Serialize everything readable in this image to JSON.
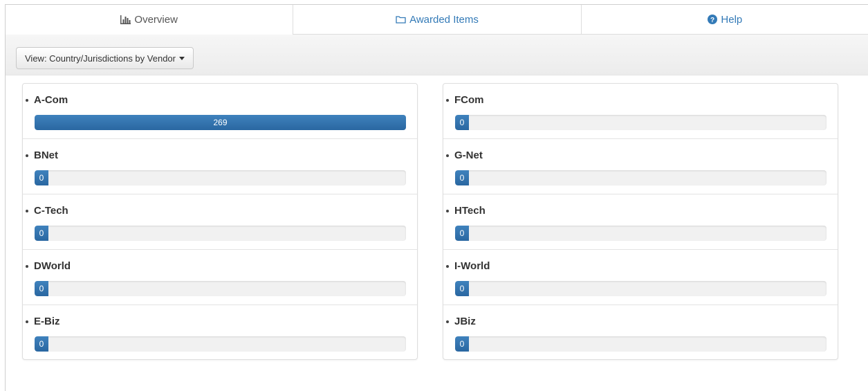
{
  "tabs": [
    {
      "label": "Overview",
      "icon": "bar-chart-icon",
      "active": true
    },
    {
      "label": "Awarded Items",
      "icon": "folder-icon",
      "active": false
    },
    {
      "label": "Help",
      "icon": "question-circle-icon",
      "active": false
    }
  ],
  "toolbar": {
    "view_label": "View: Country/Jurisdictions by Vendor"
  },
  "colors": {
    "accent": "#337ab7",
    "bar": "#2e6da4",
    "track": "#f1f1f1"
  },
  "vendors_left": [
    {
      "name": "A-Com",
      "count": "269",
      "fraction": 1.0
    },
    {
      "name": "BNet",
      "count": "0",
      "fraction": 0
    },
    {
      "name": "C-Tech",
      "count": "0",
      "fraction": 0
    },
    {
      "name": "DWorld",
      "count": "0",
      "fraction": 0
    },
    {
      "name": "E-Biz",
      "count": "0",
      "fraction": 0
    }
  ],
  "vendors_right": [
    {
      "name": "FCom",
      "count": "0",
      "fraction": 0
    },
    {
      "name": "G-Net",
      "count": "0",
      "fraction": 0
    },
    {
      "name": "HTech",
      "count": "0",
      "fraction": 0
    },
    {
      "name": "I-World",
      "count": "0",
      "fraction": 0
    },
    {
      "name": "JBiz",
      "count": "0",
      "fraction": 0
    }
  ]
}
